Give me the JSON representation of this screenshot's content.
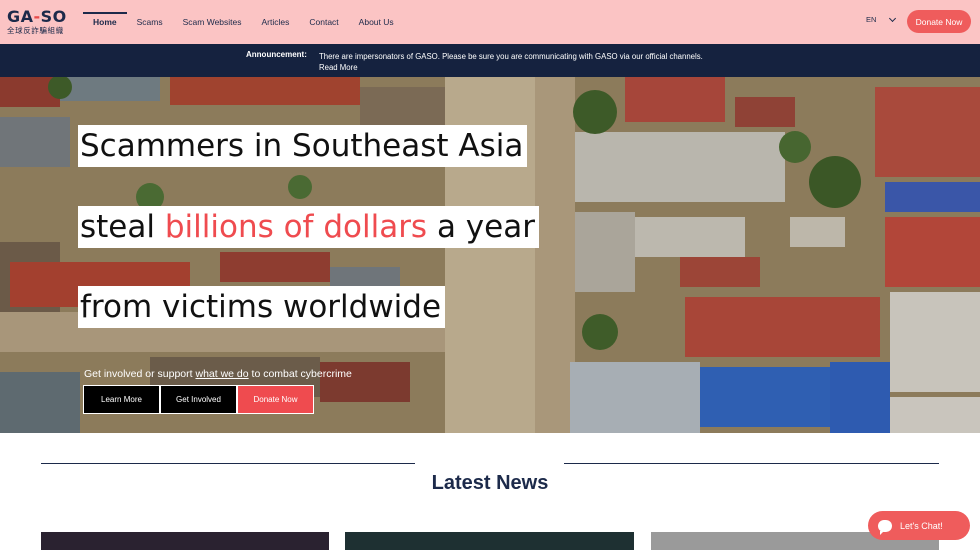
{
  "logo": {
    "main_left": "GA",
    "main_dash": "-",
    "main_right": "SO",
    "sub": "全球反詐騙組織"
  },
  "nav": {
    "items": [
      {
        "label": "Home",
        "active": true
      },
      {
        "label": "Scams"
      },
      {
        "label": "Scam Websites"
      },
      {
        "label": "Articles"
      },
      {
        "label": "Contact"
      },
      {
        "label": "About Us"
      }
    ],
    "language": "EN",
    "donate_label": "Donate Now"
  },
  "announcement": {
    "label": "Announcement:",
    "text": "There are impersonators of GASO. Please be sure you are communicating with GASO via our official channels.",
    "read_more": "Read More"
  },
  "hero": {
    "line1": "Scammers in Southeast Asia",
    "line2_pre": "steal ",
    "line2_highlight": "billions of dollars",
    "line2_post": " a year",
    "line3": "from victims worldwide",
    "sub_pre": "Get involved or support ",
    "sub_link": "what we do",
    "sub_post": " to combat cybercrime",
    "buttons": {
      "learn_more": "Learn More",
      "get_involved": "Get Involved",
      "donate": "Donate Now"
    }
  },
  "latest_news": {
    "title": "Latest News"
  },
  "chat": {
    "label": "Let's Chat!"
  },
  "colors": {
    "header_bg": "#fbc4c4",
    "navy": "#1c2a4a",
    "accent_red": "#ef4b4f",
    "announce_bg": "#15223f"
  }
}
